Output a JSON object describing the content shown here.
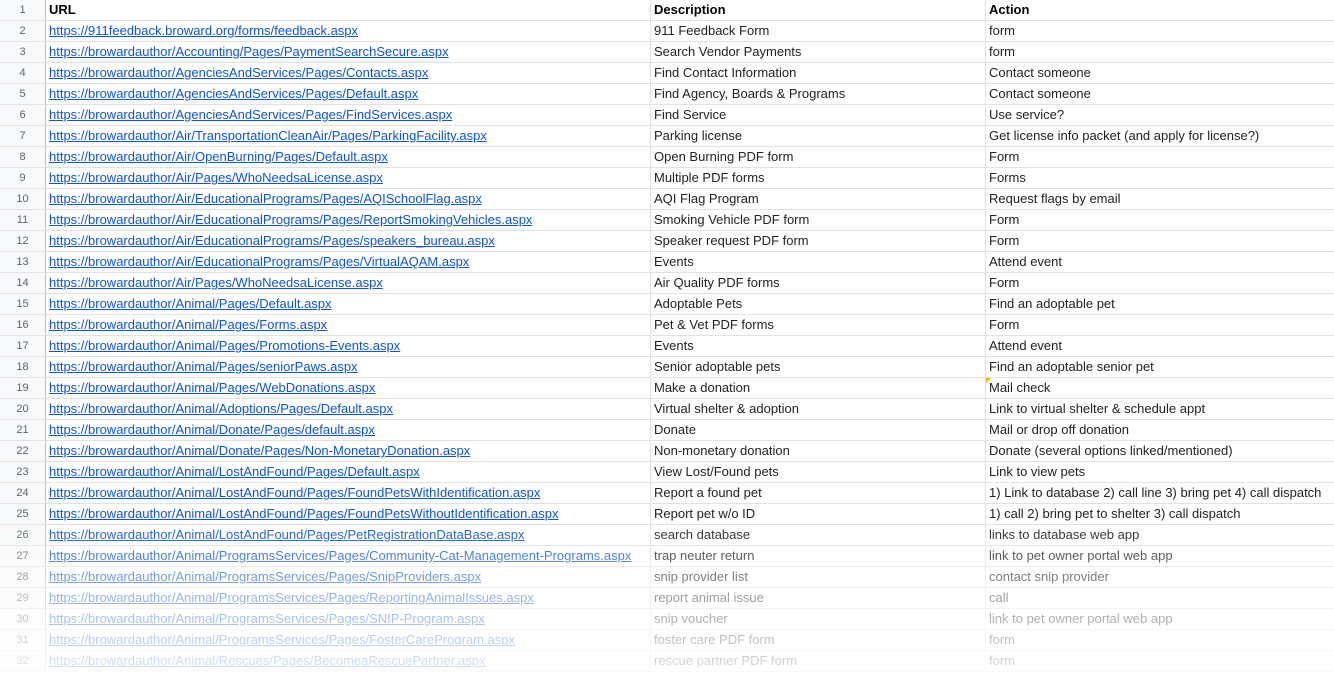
{
  "headers": {
    "row_number": "1",
    "url": "URL",
    "description": "Description",
    "action": "Action"
  },
  "rows": [
    {
      "n": "2",
      "url": "https://911feedback.broward.org/forms/feedback.aspx",
      "desc": "911 Feedback Form",
      "action": "form"
    },
    {
      "n": "3",
      "url": "https://browardauthor/Accounting/Pages/PaymentSearchSecure.aspx",
      "desc": "Search Vendor Payments",
      "action": "form"
    },
    {
      "n": "4",
      "url": "https://browardauthor/AgenciesAndServices/Pages/Contacts.aspx",
      "desc": "Find Contact Information",
      "action": "Contact someone"
    },
    {
      "n": "5",
      "url": "https://browardauthor/AgenciesAndServices/Pages/Default.aspx",
      "desc": "Find Agency, Boards & Programs",
      "action": "Contact someone"
    },
    {
      "n": "6",
      "url": "https://browardauthor/AgenciesAndServices/Pages/FindServices.aspx",
      "desc": "Find Service",
      "action": "Use service?"
    },
    {
      "n": "7",
      "url": "https://browardauthor/Air/TransportationCleanAir/Pages/ParkingFacility.aspx",
      "desc": "Parking license",
      "action": "Get license info packet (and apply for license?)"
    },
    {
      "n": "8",
      "url": "https://browardauthor/Air/OpenBurning/Pages/Default.aspx",
      "desc": "Open Burning PDF form",
      "action": "Form"
    },
    {
      "n": "9",
      "url": "https://browardauthor/Air/Pages/WhoNeedsaLicense.aspx",
      "desc": "Multiple PDF forms",
      "action": "Forms"
    },
    {
      "n": "10",
      "url": "https://browardauthor/Air/EducationalPrograms/Pages/AQISchoolFlag.aspx",
      "desc": "AQI Flag Program",
      "action": "Request flags by email"
    },
    {
      "n": "11",
      "url": "https://browardauthor/Air/EducationalPrograms/Pages/ReportSmokingVehicles.aspx",
      "desc": "Smoking Vehicle PDF form",
      "action": "Form"
    },
    {
      "n": "12",
      "url": "https://browardauthor/Air/EducationalPrograms/Pages/speakers_bureau.aspx",
      "desc": "Speaker request PDF form",
      "action": "Form"
    },
    {
      "n": "13",
      "url": "https://browardauthor/Air/EducationalPrograms/Pages/VirtualAQAM.aspx",
      "desc": "Events",
      "action": "Attend event"
    },
    {
      "n": "14",
      "url": "https://browardauthor/Air/Pages/WhoNeedsaLicense.aspx",
      "desc": "Air Quality PDF forms",
      "action": "Form"
    },
    {
      "n": "15",
      "url": "https://browardauthor/Animal/Pages/Default.aspx",
      "desc": "Adoptable Pets",
      "action": "Find an adoptable pet"
    },
    {
      "n": "16",
      "url": "https://browardauthor/Animal/Pages/Forms.aspx",
      "desc": "Pet & Vet PDF forms",
      "action": "Form"
    },
    {
      "n": "17",
      "url": "https://browardauthor/Animal/Pages/Promotions-Events.aspx",
      "desc": "Events",
      "action": "Attend event"
    },
    {
      "n": "18",
      "url": "https://browardauthor/Animal/Pages/seniorPaws.aspx",
      "desc": "Senior adoptable pets",
      "action": "Find an adoptable senior pet"
    },
    {
      "n": "19",
      "url": "https://browardauthor/Animal/Pages/WebDonations.aspx",
      "desc": "Make a donation",
      "action": "Mail check",
      "note": true
    },
    {
      "n": "20",
      "url": "https://browardauthor/Animal/Adoptions/Pages/Default.aspx",
      "desc": "Virtual shelter & adoption",
      "action": "Link to virtual shelter & schedule appt"
    },
    {
      "n": "21",
      "url": "https://browardauthor/Animal/Donate/Pages/default.aspx",
      "desc": "Donate",
      "action": "Mail or drop off donation"
    },
    {
      "n": "22",
      "url": "https://browardauthor/Animal/Donate/Pages/Non-MonetaryDonation.aspx",
      "desc": "Non-monetary donation",
      "action": "Donate (several options linked/mentioned)"
    },
    {
      "n": "23",
      "url": "https://browardauthor/Animal/LostAndFound/Pages/Default.aspx",
      "desc": "View Lost/Found pets",
      "action": "Link to view pets"
    },
    {
      "n": "24",
      "url": "https://browardauthor/Animal/LostAndFound/Pages/FoundPetsWithIdentification.aspx",
      "desc": "Report a found pet",
      "action": "1) Link to database 2) call line 3) bring pet 4) call dispatch"
    },
    {
      "n": "25",
      "url": "https://browardauthor/Animal/LostAndFound/Pages/FoundPetsWithoutIdentification.aspx",
      "desc": "Report pet w/o ID",
      "action": "1) call 2) bring pet to shelter 3) call dispatch"
    },
    {
      "n": "26",
      "url": "https://browardauthor/Animal/LostAndFound/Pages/PetRegistrationDataBase.aspx",
      "desc": "search database",
      "action": "links to database web app"
    },
    {
      "n": "27",
      "url": "https://browardauthor/Animal/ProgramsServices/Pages/Community-Cat-Management-Programs.aspx",
      "desc": "trap neuter return",
      "action": "link to pet owner portal web app"
    },
    {
      "n": "28",
      "url": "https://browardauthor/Animal/ProgramsServices/Pages/SnipProviders.aspx",
      "desc": "snip provider list",
      "action": "contact snip provider"
    },
    {
      "n": "29",
      "url": "https://browardauthor/Animal/ProgramsServices/Pages/ReportingAnimalIssues.aspx",
      "desc": "report animal issue",
      "action": "call"
    },
    {
      "n": "30",
      "url": "https://browardauthor/Animal/ProgramsServices/Pages/SNIP-Program.aspx",
      "desc": "snip voucher",
      "action": "link to pet owner portal web app"
    },
    {
      "n": "31",
      "url": "https://browardauthor/Animal/ProgramsServices/Pages/FosterCareProgram.aspx",
      "desc": "foster care PDF form",
      "action": "form"
    },
    {
      "n": "32",
      "url": "https://browardauthor/Animal/Rescues/Pages/BecomeaRescuePartner.aspx",
      "desc": "rescue partner PDF form",
      "action": "form"
    }
  ],
  "colors": {
    "link": "#1155cc",
    "header_bg": "#f8f9fa",
    "note": "#f4b400"
  }
}
